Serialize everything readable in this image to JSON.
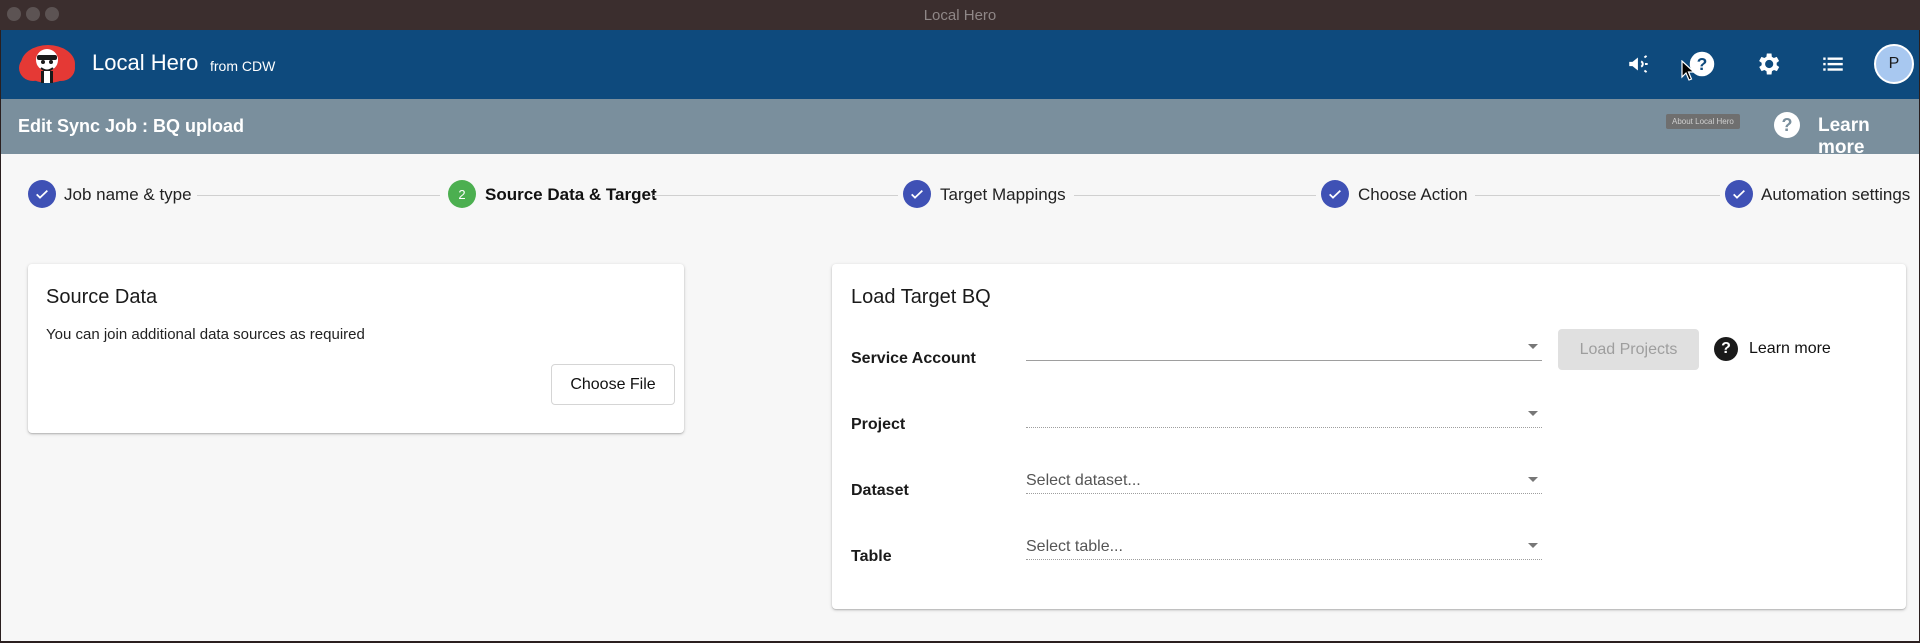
{
  "window": {
    "title": "Local Hero"
  },
  "appbar": {
    "app_name": "Local Hero",
    "app_sub": "from CDW",
    "icons": [
      "megaphone-icon",
      "help-icon",
      "gear-icon",
      "list-icon"
    ],
    "avatar_initial": "P",
    "tooltip": "About Local Hero"
  },
  "subbar": {
    "title": "Edit Sync Job : BQ upload",
    "help_glyph": "?",
    "learn_more": "Learn more"
  },
  "stepper": {
    "steps": [
      {
        "label": "Job name & type",
        "state": "done"
      },
      {
        "label": "Source Data & Target",
        "state": "active",
        "number": "2"
      },
      {
        "label": "Target Mappings",
        "state": "done"
      },
      {
        "label": "Choose Action",
        "state": "done"
      },
      {
        "label": "Automation settings",
        "state": "done"
      }
    ]
  },
  "source_card": {
    "title": "Source Data",
    "description": "You can join additional data sources as required",
    "button": "Choose File"
  },
  "target_card": {
    "title": "Load Target BQ",
    "fields": {
      "service_account": {
        "label": "Service Account",
        "value": ""
      },
      "project": {
        "label": "Project",
        "value": ""
      },
      "dataset": {
        "label": "Dataset",
        "placeholder": "Select dataset..."
      },
      "table": {
        "label": "Table",
        "placeholder": "Select table..."
      }
    },
    "load_projects_button": "Load Projects",
    "help_glyph": "?",
    "learn_more": "Learn more"
  },
  "colors": {
    "appbar": "#0e4a7d",
    "subbar": "#7a8f9d",
    "step_done": "#3f51b5",
    "step_active": "#4caf50"
  }
}
